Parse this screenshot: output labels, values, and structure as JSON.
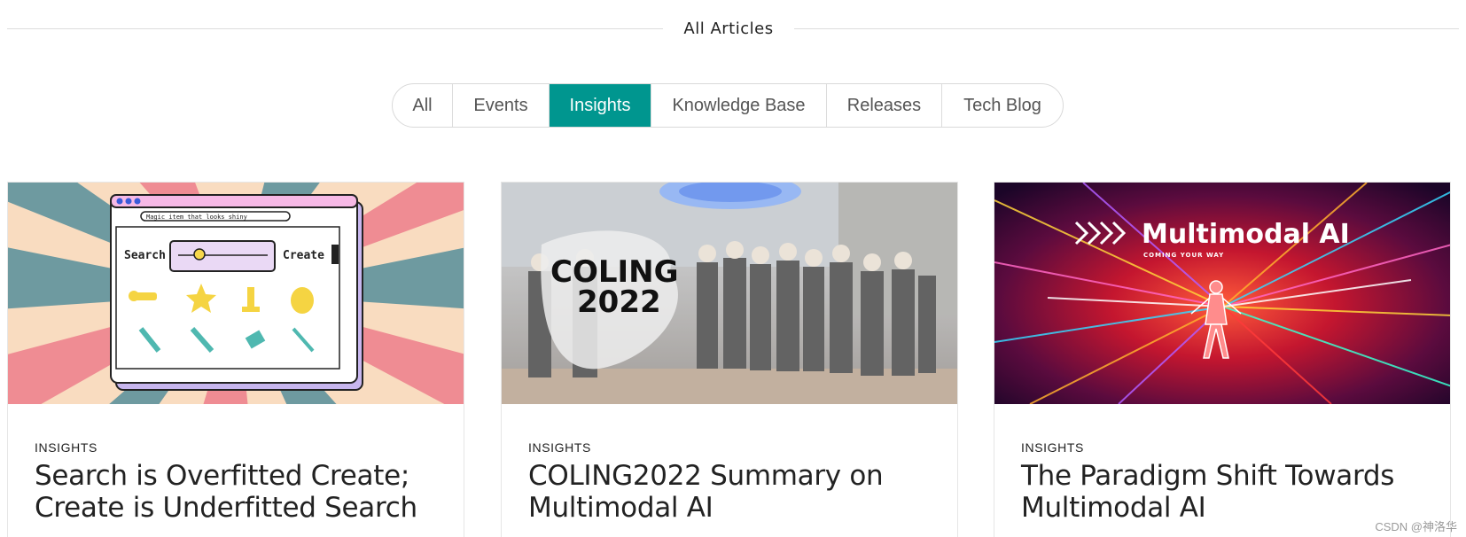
{
  "section": {
    "title": "All Articles"
  },
  "filters": [
    {
      "label": "All",
      "active": false
    },
    {
      "label": "Events",
      "active": false
    },
    {
      "label": "Insights",
      "active": true
    },
    {
      "label": "Knowledge Base",
      "active": false
    },
    {
      "label": "Releases",
      "active": false
    },
    {
      "label": "Tech Blog",
      "active": false
    }
  ],
  "cards": [
    {
      "category": "INSIGHTS",
      "title": "Search is Overfitted Create; Create is Underfitted Search",
      "image": {
        "search_bar_text": "Magic item that looks shiny",
        "left_label": "Search",
        "right_label": "Create"
      }
    },
    {
      "category": "INSIGHTS",
      "title": "COLING2022 Summary on Multimodal AI",
      "image": {
        "logo_line1": "COLING",
        "logo_line2": "2022"
      }
    },
    {
      "category": "INSIGHTS",
      "title": "The Paradigm Shift Towards Multimodal AI",
      "image": {
        "headline": "Multimodal AI",
        "tagline": "COMING YOUR WAY"
      }
    }
  ],
  "watermark": "CSDN @神洛华",
  "colors": {
    "accent": "#00968f",
    "border": "#dcdcdc"
  }
}
